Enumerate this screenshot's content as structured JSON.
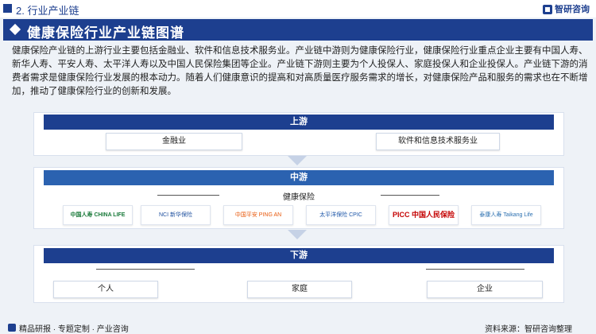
{
  "header": {
    "section": "2. 行业产业链",
    "brand": "智研咨询"
  },
  "title": "健康保险行业产业链图谱",
  "intro": "健康保险产业链的上游行业主要包括金融业、软件和信息技术服务业。产业链中游则为健康保险行业，健康保险行业重点企业主要有中国人寿、新华人寿、平安人寿、太平洋人寿以及中国人民保险集团等企业。产业链下游则主要为个人投保人、家庭投保人和企业投保人。产业链下游的消费者需求是健康保险行业发展的根本动力。随着人们健康意识的提高和对高质量医疗服务需求的增长，对健康保险产品和服务的需求也在不断增加，推动了健康保险行业的创新和发展。",
  "upstream": {
    "label": "上游",
    "items": [
      "金融业",
      "软件和信息技术服务业"
    ]
  },
  "midstream": {
    "label": "中游",
    "sublabel": "健康保险",
    "logos": [
      "中国人寿 CHINA LIFE",
      "NCI 新华保险",
      "中国平安 PING AN",
      "太平洋保险 CPIC",
      "PICC 中国人民保险",
      "泰康人寿 Taikang Life"
    ]
  },
  "downstream": {
    "label": "下游",
    "items": [
      "个人",
      "家庭",
      "企业"
    ]
  },
  "footer": {
    "left": "精品研报 · 专题定制 · 产业咨询",
    "right": "资料来源：智研咨询整理"
  },
  "colors": {
    "primary": "#1d3f8f",
    "secondary": "#2b62b0",
    "background": "#eef2f7"
  }
}
